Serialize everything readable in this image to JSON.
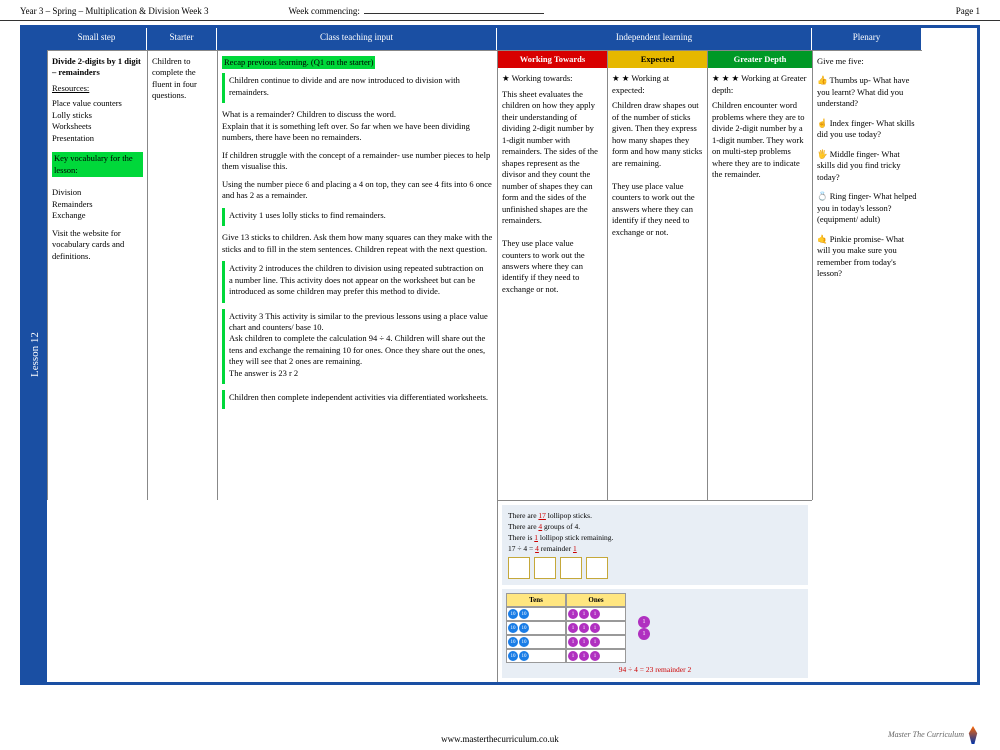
{
  "header": {
    "title": "Year 3 – Spring – Multiplication & Division Week 3",
    "week_label": "Week commencing:",
    "page": "Page 1"
  },
  "lesson_tab": "Lesson 12",
  "columns": {
    "smallstep": "Small step",
    "starter": "Starter",
    "teaching": "Class teaching input",
    "independent": "Independent learning",
    "plenary": "Plenary"
  },
  "smallstep": {
    "title": "Divide 2-digits by 1 digit – remainders",
    "resources_label": "Resources:",
    "resources": "Place value counters\nLolly sticks\nWorksheets\nPresentation",
    "vocab_label": "Key vocabulary for the lesson:",
    "vocab": "Division\nRemainders\nExchange",
    "footnote": "Visit the website for vocabulary cards and definitions."
  },
  "starter": "Children to complete the fluent in four questions.",
  "teaching": {
    "recap": "Recap previous learning. (Q1 on the starter)",
    "p1": "Children continue to divide and are now introduced to division with remainders.",
    "p2": "What is a remainder? Children to discuss the word.\nExplain that it is something left over. So far when we have been dividing numbers, there have been no remainders.",
    "p3": "If children struggle with the concept of a remainder- use number pieces to help them visualise this.",
    "p4": "Using the number piece 6 and placing a 4 on top, they can see 4 fits into 6 once and has 2 as a remainder.",
    "p5": "Activity 1 uses lolly sticks to find remainders.",
    "p6": "Give 13 sticks to children. Ask them how many squares can they make with the sticks and to fill in the stem sentences. Children repeat with the next question.",
    "p7": "Activity 2 introduces the children to division using repeated subtraction on a number line. This activity does not appear on the worksheet but can be introduced as some children may prefer this method to divide.",
    "p8": "Activity 3 This activity is similar to the previous lessons using a place value chart and counters/ base 10.\nAsk children to complete the calculation 94 ÷ 4. Children will share out the tens and exchange the remaining 10 for ones. Once they share out the ones, they will see that 2 ones are remaining.\nThe answer is 23 r 2",
    "p9": "Children then complete independent activities via differentiated worksheets."
  },
  "independent": {
    "wt": {
      "header": "Working Towards",
      "stars": "★  Working towards:",
      "body": "This sheet evaluates the children on how they apply their understanding of dividing 2-digit number by 1-digit number with remainders. The sides of the shapes represent as the divisor and they count the number of shapes they can form and the sides of the unfinished shapes are the remainders.\n\nThey use place value counters to work out the answers where they can identify if they need to exchange or not."
    },
    "ex": {
      "header": "Expected",
      "stars": "★ ★  Working at expected:",
      "body": "Children draw shapes out of the number of sticks given. Then they express how many shapes they form and how many sticks are remaining.\n\nThey use place value counters to work out the answers where they can identify if they need to exchange or not."
    },
    "gd": {
      "header": "Greater Depth",
      "stars": "★ ★ ★  Working at Greater depth:",
      "body": "Children encounter word problems where they are to divide 2-digit number by a 1-digit number. They work on multi-step problems where they are to indicate the remainder."
    }
  },
  "diagrams": {
    "d1": {
      "l1a": "There are ",
      "l1b": "17",
      "l1c": " lollipop sticks.",
      "l2a": "There are ",
      "l2b": "4",
      "l2c": " groups of 4.",
      "l3a": "There is ",
      "l3b": "1",
      "l3c": " lollipop stick remaining.",
      "l4a": "17 ÷ 4 = ",
      "l4b": "4",
      "l4c": " remainder ",
      "l4d": "1"
    },
    "d2": {
      "tens": "Tens",
      "ones": "Ones",
      "answer": "94 ÷ 4 = 23 remainder 2"
    }
  },
  "plenary": {
    "intro": "Give me five:",
    "p1": "👍 Thumbs up- What have you learnt? What did you understand?",
    "p2": "☝ Index finger- What skills did you use today?",
    "p3": "🖐 Middle finger- What skills did you find tricky today?",
    "p4": "💍 Ring finger- What helped you in today's lesson? (equipment/ adult)",
    "p5": "🤙 Pinkie promise- What will you make sure you remember from today's lesson?"
  },
  "footer": {
    "url": "www.masterthecurriculum.co.uk",
    "brand": "Master The Curriculum"
  }
}
